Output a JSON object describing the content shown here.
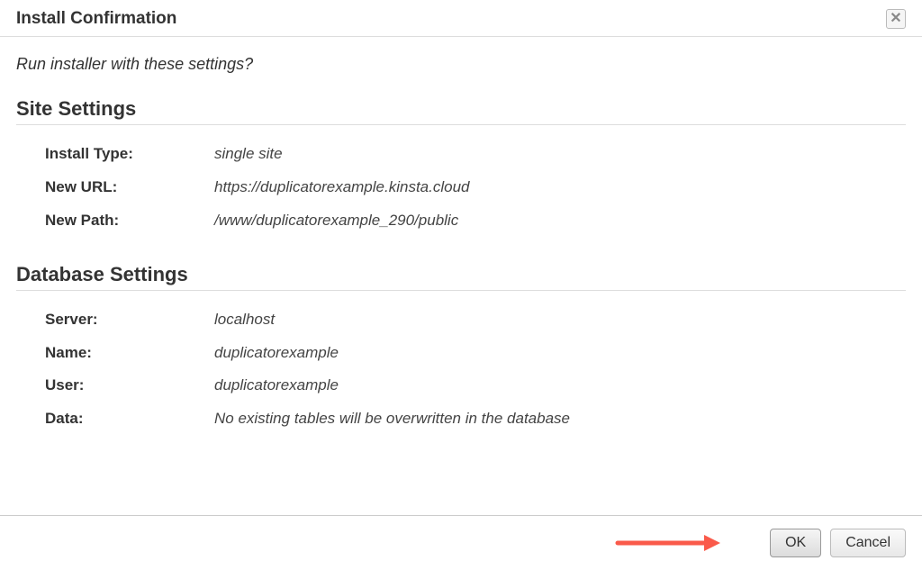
{
  "dialog": {
    "title": "Install Confirmation",
    "prompt": "Run installer with these settings?"
  },
  "site_settings": {
    "heading": "Site Settings",
    "rows": {
      "install_type": {
        "label": "Install Type:",
        "value": "single site"
      },
      "new_url": {
        "label": "New URL:",
        "value": "https://duplicatorexample.kinsta.cloud"
      },
      "new_path": {
        "label": "New Path:",
        "value": "/www/duplicatorexample_290/public"
      }
    }
  },
  "database_settings": {
    "heading": "Database Settings",
    "rows": {
      "server": {
        "label": "Server:",
        "value": "localhost"
      },
      "name": {
        "label": "Name:",
        "value": "duplicatorexample"
      },
      "user": {
        "label": "User:",
        "value": "duplicatorexample"
      },
      "data": {
        "label": "Data:",
        "value": "No existing tables will be overwritten in the database"
      }
    }
  },
  "buttons": {
    "ok": "OK",
    "cancel": "Cancel"
  }
}
